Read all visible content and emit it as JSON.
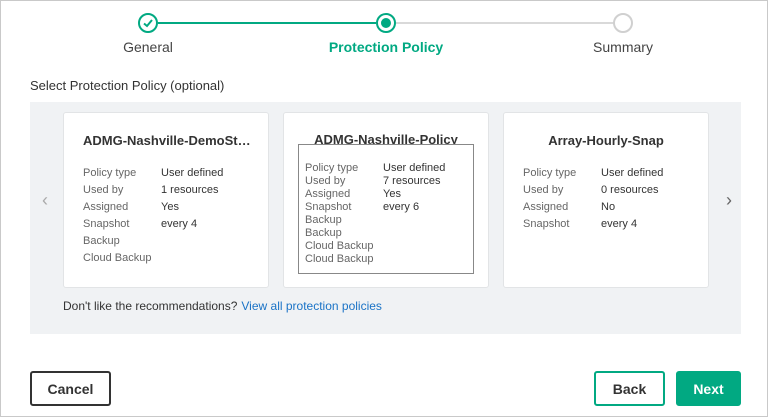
{
  "stepper": {
    "steps": [
      {
        "label": "General",
        "state": "done"
      },
      {
        "label": "Protection Policy",
        "state": "current"
      },
      {
        "label": "Summary",
        "state": "todo"
      }
    ]
  },
  "section_title": "Select Protection Policy (optional)",
  "cards": [
    {
      "title": "ADMG-Nashville-DemoStor...",
      "rows": [
        {
          "key": "Policy type",
          "value": "User defined"
        },
        {
          "key": "Used by",
          "value": "1 resources"
        },
        {
          "key": "Assigned",
          "value": "Yes"
        },
        {
          "key": "Snapshot",
          "value": "every 4"
        },
        {
          "key": "Backup",
          "value": ""
        },
        {
          "key": "Cloud Backup",
          "value": ""
        }
      ]
    },
    {
      "title": "ADMG-Nashville-Policy",
      "rows": [
        {
          "key": "Policy type",
          "value": "User defined"
        },
        {
          "key": "Used by",
          "value": "7 resources"
        },
        {
          "key": "Assigned",
          "value": "Yes"
        },
        {
          "key": "Snapshot",
          "value": "every 6"
        },
        {
          "key": "Backup",
          "value": ""
        },
        {
          "key": "Backup",
          "value": ""
        },
        {
          "key": "Cloud Backup",
          "value": ""
        },
        {
          "key": "Cloud Backup",
          "value": ""
        }
      ]
    },
    {
      "title": "Array-Hourly-Snap",
      "rows": [
        {
          "key": "Policy type",
          "value": "User defined"
        },
        {
          "key": "Used by",
          "value": "0 resources"
        },
        {
          "key": "Assigned",
          "value": "No"
        },
        {
          "key": "Snapshot",
          "value": "every 4"
        }
      ]
    }
  ],
  "footnote": {
    "text": "Don't like the recommendations?",
    "link": "View all protection policies"
  },
  "buttons": {
    "cancel": "Cancel",
    "back": "Back",
    "next": "Next"
  },
  "colors": {
    "accent": "#01a982",
    "link": "#1a73c6"
  }
}
